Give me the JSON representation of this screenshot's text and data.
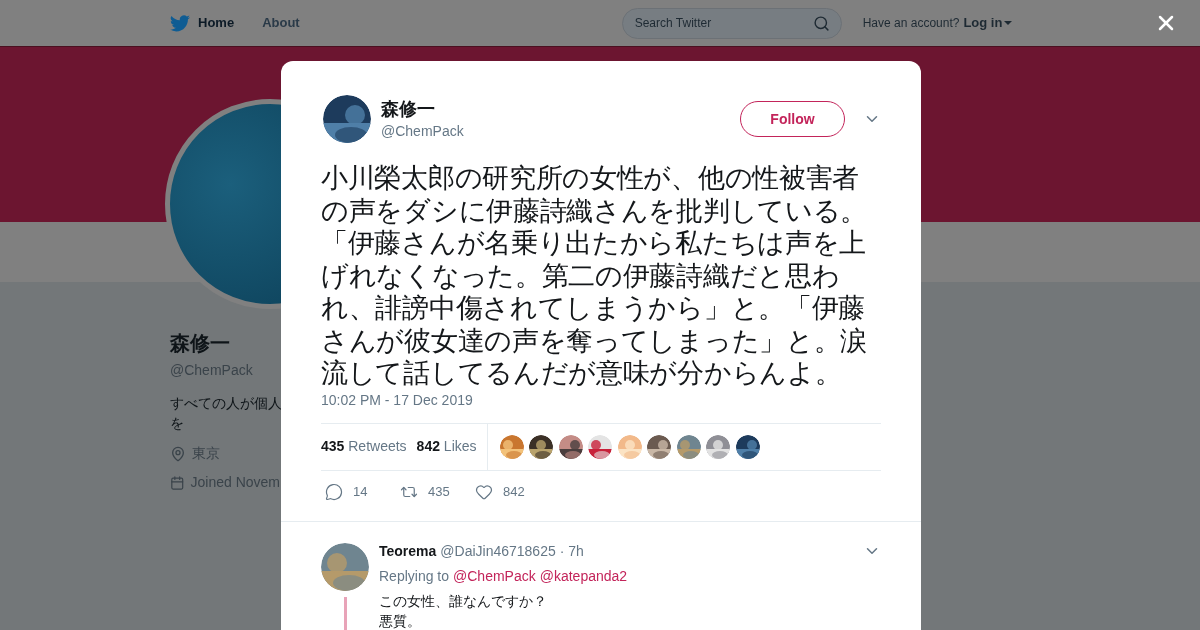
{
  "header": {
    "nav": [
      {
        "label": "Home",
        "selected": true
      },
      {
        "label": "About",
        "selected": false
      }
    ],
    "search": {
      "placeholder": "Search Twitter"
    },
    "account_prompt": "Have an account?",
    "login": "Log in"
  },
  "profile": {
    "name": "森修一",
    "handle": "@ChemPack",
    "bio_lines": [
      "すべての人が個人",
      "を"
    ],
    "location": "東京",
    "joined": "Joined Novem"
  },
  "tweet": {
    "name": "森修一",
    "handle": "@ChemPack",
    "follow": "Follow",
    "text": "小川榮太郎の研究所の女性が、他の性被害者の声をダシに伊藤詩織さんを批判している。「伊藤さんが名乗り出たから私たちは声を上げれなくなった。第二の伊藤詩織だと思われ、誹謗中傷されてしまうから」と。「伊藤さんが彼女達の声を奪ってしまった」と。涙流して話してるんだが意味が分からんよ。",
    "time": "10:02 PM - 17 Dec 2019",
    "stats": [
      {
        "count": "435",
        "label": "Retweets"
      },
      {
        "count": "842",
        "label": "Likes"
      }
    ],
    "actions": [
      {
        "kind": "reply",
        "count": "14"
      },
      {
        "kind": "retweet",
        "count": "435"
      },
      {
        "kind": "like",
        "count": "842"
      }
    ]
  },
  "reply": {
    "name": "Teorema",
    "handle": "@DaiJin46718625",
    "age": "· 7h",
    "replying_prefix": "Replying to",
    "mentions": [
      "@ChemPack",
      "@katepanda2"
    ],
    "lines": [
      "この女性、誰なんですか？",
      "悪質。"
    ]
  }
}
